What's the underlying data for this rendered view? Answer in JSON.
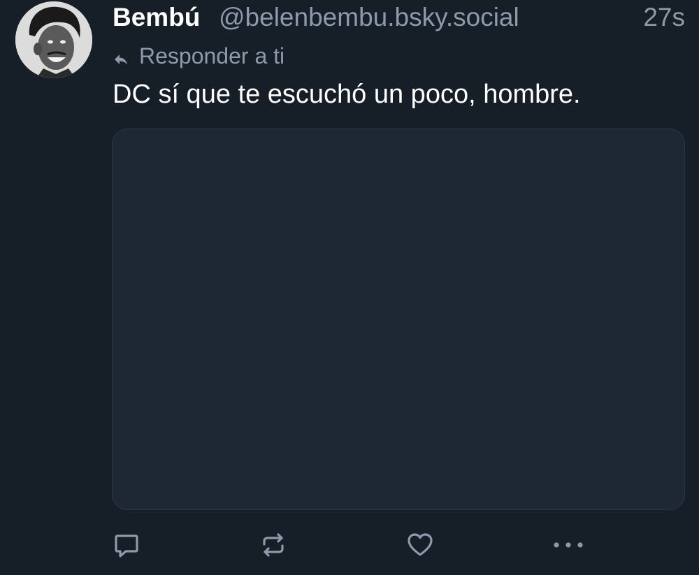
{
  "post": {
    "author": {
      "display_name": "Bembú",
      "handle": "@belenbembu.bsky.social"
    },
    "timestamp": "27s",
    "reply_context": "Responder a ti",
    "text": "DC sí que te escuchó un poco, hombre."
  },
  "actions": {
    "reply_icon": "speech-bubble-icon",
    "repost_icon": "repost-arrows-icon",
    "like_icon": "heart-icon",
    "more_icon": "ellipsis-icon"
  },
  "colors": {
    "background": "#161e27",
    "secondary_text": "#8c9aab",
    "embed_background": "#1e2834"
  }
}
